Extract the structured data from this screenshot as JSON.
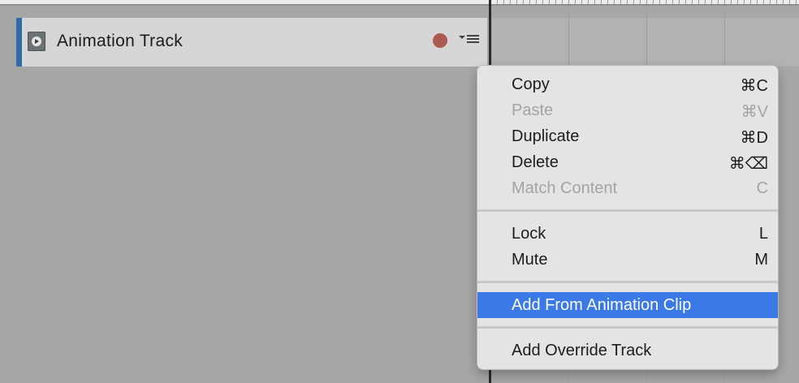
{
  "track": {
    "name": "Animation Track",
    "icon": "animation-track-icon",
    "record_icon": "record-dot",
    "menu_icon": "track-options-icon"
  },
  "context_menu": {
    "items": [
      {
        "label": "Copy",
        "shortcut": "⌘C",
        "state": "enabled"
      },
      {
        "label": "Paste",
        "shortcut": "⌘V",
        "state": "disabled"
      },
      {
        "label": "Duplicate",
        "shortcut": "⌘D",
        "state": "enabled"
      },
      {
        "label": "Delete",
        "shortcut": "⌘⌫",
        "state": "enabled"
      },
      {
        "label": "Match Content",
        "shortcut": "C",
        "state": "disabled"
      },
      {
        "label": "Lock",
        "shortcut": "L",
        "state": "enabled"
      },
      {
        "label": "Mute",
        "shortcut": "M",
        "state": "enabled"
      },
      {
        "label": "Add From Animation Clip",
        "shortcut": "",
        "state": "highlighted"
      },
      {
        "label": "Add Override Track",
        "shortcut": "",
        "state": "enabled"
      }
    ]
  },
  "colors": {
    "track_accent": "#2f6aa9",
    "record": "#ac5b51",
    "menu_highlight": "#3a79e6",
    "panel_background": "#a6a6a6"
  }
}
